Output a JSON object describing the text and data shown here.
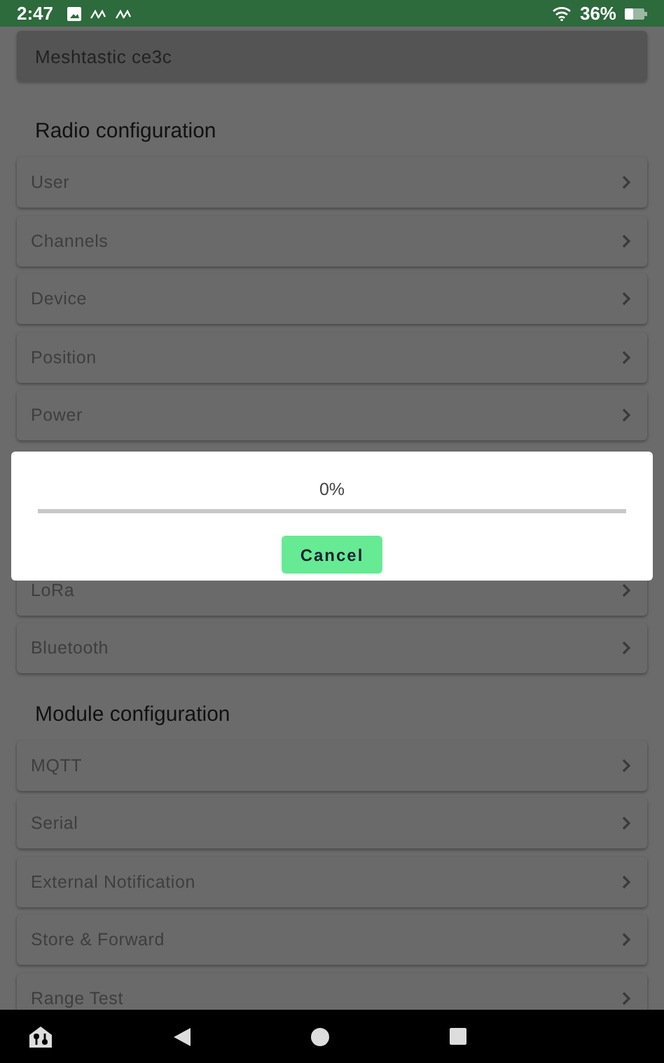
{
  "status_bar": {
    "time": "2:47",
    "battery_text": "36%"
  },
  "device_card": {
    "label": "Meshtastic ce3c"
  },
  "sections": [
    {
      "title": "Radio configuration",
      "items": [
        {
          "label": "User"
        },
        {
          "label": "Channels"
        },
        {
          "label": "Device"
        },
        {
          "label": "Position"
        },
        {
          "label": "Power"
        },
        {
          "kind": "hidden"
        },
        {
          "kind": "hidden"
        },
        {
          "label": "LoRa"
        },
        {
          "label": "Bluetooth"
        }
      ]
    },
    {
      "title": "Module configuration",
      "items": [
        {
          "label": "MQTT"
        },
        {
          "label": "Serial"
        },
        {
          "label": "External Notification"
        },
        {
          "label": "Store & Forward"
        },
        {
          "label": "Range Test"
        }
      ]
    }
  ],
  "dialog": {
    "percent": "0%",
    "level": 0,
    "button": "Cancel"
  }
}
